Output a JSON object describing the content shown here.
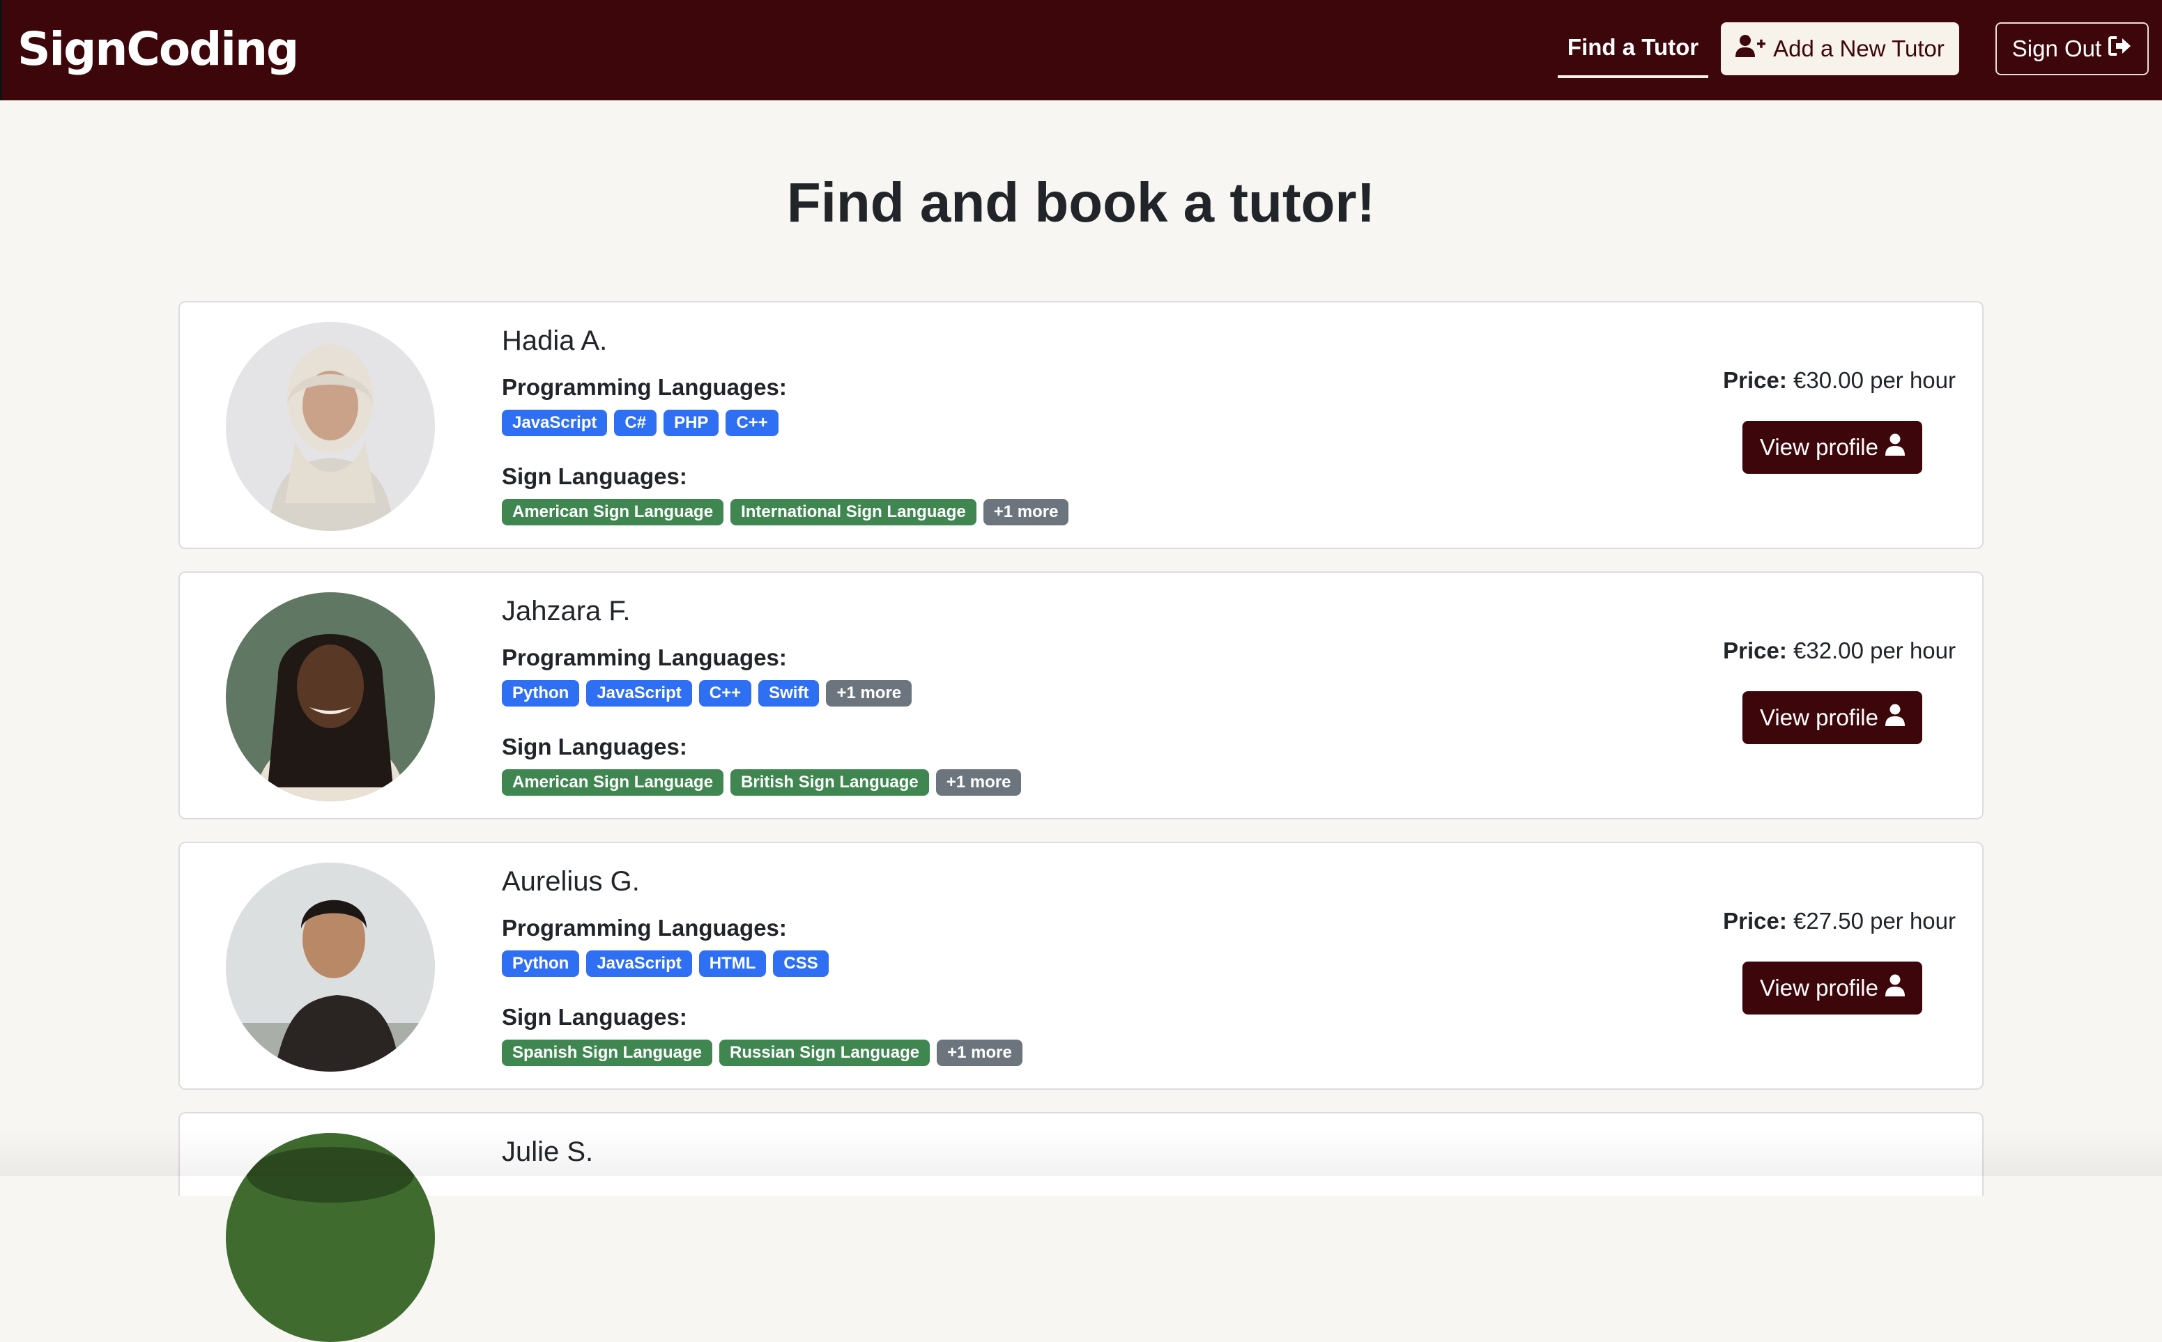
{
  "navbar": {
    "brand": "SignCoding",
    "find_tutor": "Find a Tutor",
    "add_tutor": "Add a New Tutor",
    "sign_out": "Sign Out"
  },
  "page": {
    "title": "Find and book a tutor!"
  },
  "labels": {
    "programming": "Programming Languages:",
    "sign": "Sign Languages:",
    "price": "Price:",
    "view_profile": "View profile"
  },
  "tutors": [
    {
      "name": "Hadia A.",
      "price": "€30.00 per hour",
      "programming": [
        "JavaScript",
        "C#",
        "PHP",
        "C++"
      ],
      "programming_more": "",
      "sign": [
        "American Sign Language",
        "International Sign Language"
      ],
      "sign_more": "+1 more"
    },
    {
      "name": "Jahzara F.",
      "price": "€32.00 per hour",
      "programming": [
        "Python",
        "JavaScript",
        "C++",
        "Swift"
      ],
      "programming_more": "+1 more",
      "sign": [
        "American Sign Language",
        "British Sign Language"
      ],
      "sign_more": "+1 more"
    },
    {
      "name": "Aurelius G.",
      "price": "€27.50 per hour",
      "programming": [
        "Python",
        "JavaScript",
        "HTML",
        "CSS"
      ],
      "programming_more": "",
      "sign": [
        "Spanish Sign Language",
        "Russian Sign Language"
      ],
      "sign_more": "+1 more"
    },
    {
      "name": "Julie S."
    }
  ],
  "icons": {
    "add": "user-plus-icon",
    "signout": "sign-out-icon",
    "profile": "user-icon"
  },
  "colors": {
    "brand": "#3d060a",
    "programming_badge": "#2f6ff3",
    "sign_badge": "#3f8650",
    "more_badge": "#6c757d"
  }
}
